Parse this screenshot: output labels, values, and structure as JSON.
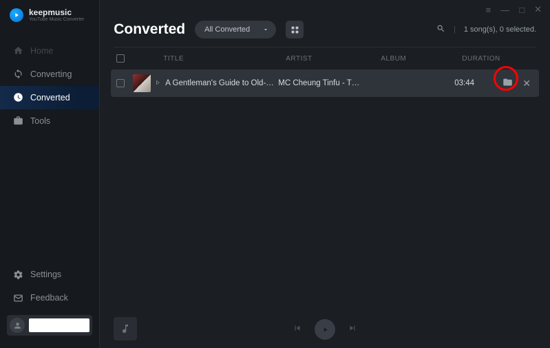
{
  "app": {
    "name": "keepmusic",
    "subtitle": "YouTube Music Converter"
  },
  "sidebar": {
    "items": [
      {
        "label": "Home"
      },
      {
        "label": "Converting"
      },
      {
        "label": "Converted"
      },
      {
        "label": "Tools"
      }
    ],
    "bottom": [
      {
        "label": "Settings"
      },
      {
        "label": "Feedback"
      }
    ]
  },
  "header": {
    "title": "Converted",
    "filter": "All Converted",
    "status": "1 song(s), 0 selected."
  },
  "columns": {
    "title": "TITLE",
    "artist": "ARTIST",
    "album": "ALBUM",
    "duration": "DURATION"
  },
  "rows": [
    {
      "title": "A Gentleman's Guide to Old-…",
      "artist": "MC Cheung Tinfu - T…",
      "album": "",
      "duration": "03:44"
    }
  ]
}
